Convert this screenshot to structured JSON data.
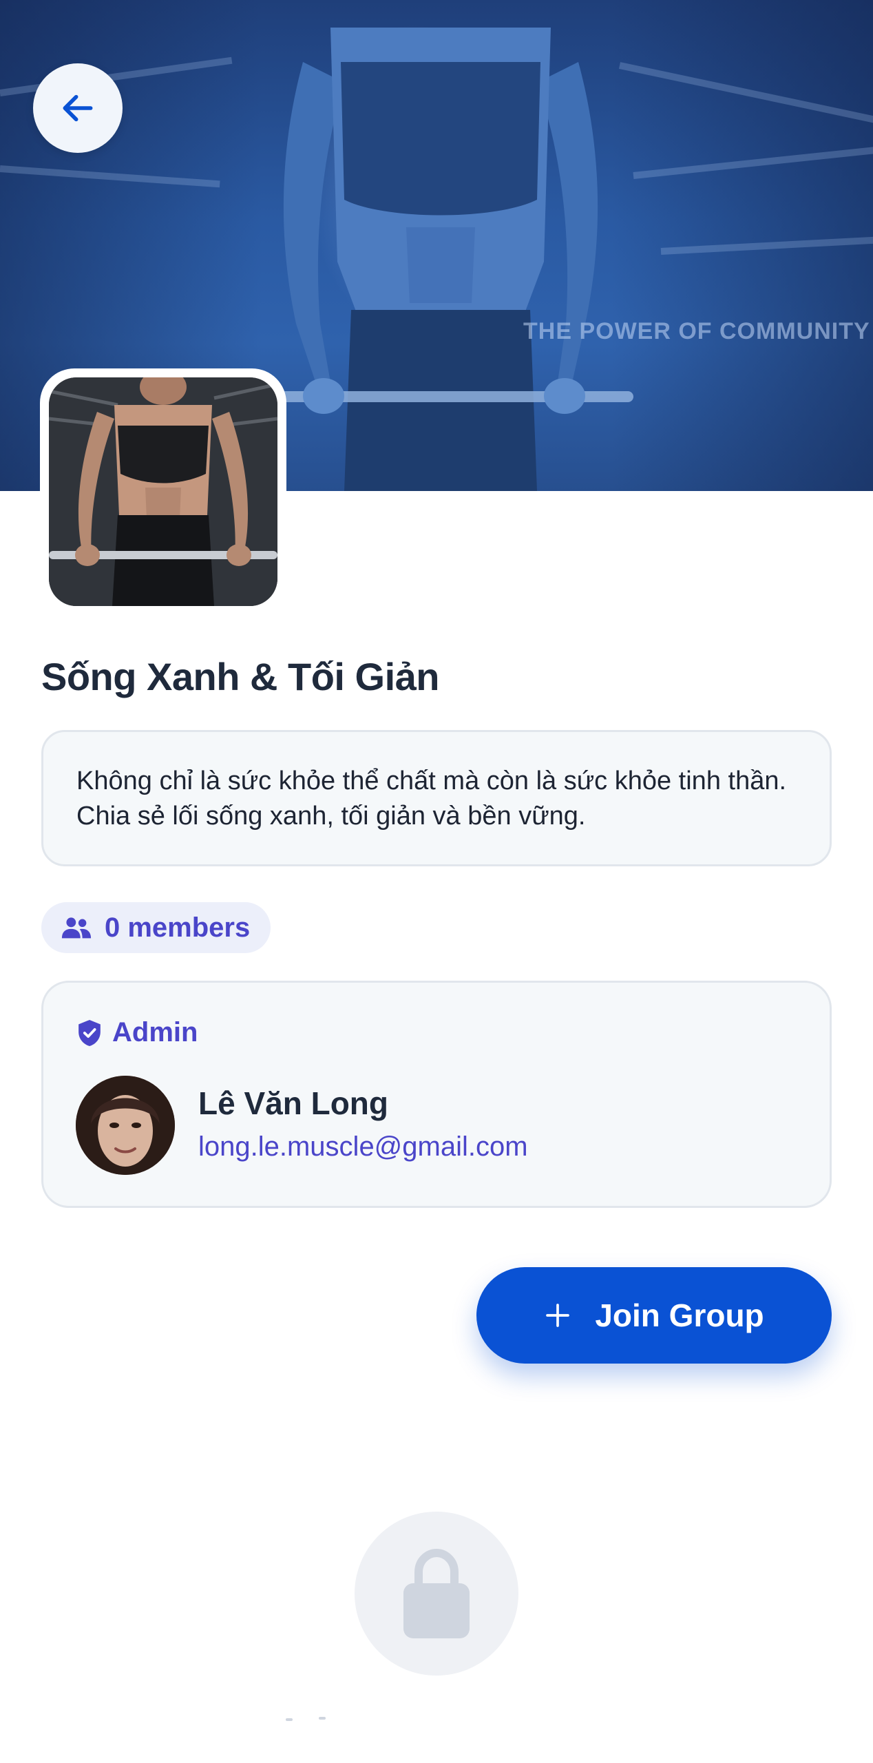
{
  "header": {
    "back_icon": "arrow-left-icon",
    "cover_text": "THE POWER OF COMMUNITY"
  },
  "group": {
    "name": "Sống Xanh & Tối Giản",
    "description": "Không chỉ là sức khỏe thể chất mà còn là sức khỏe tinh thần. Chia sẻ lối sống xanh, tối giản và bền vững.",
    "members_label": "0 members",
    "members_icon": "group-people-icon"
  },
  "admin": {
    "label": "Admin",
    "badge_icon": "shield-check-icon",
    "name": "Lê Văn Long",
    "email": "long.le.muscle@gmail.com"
  },
  "actions": {
    "join_label": "Join Group",
    "join_icon": "plus-icon"
  },
  "locked": {
    "icon": "lock-icon"
  },
  "colors": {
    "primary": "#0a52d4",
    "accent": "#4a45c9",
    "title": "#1f2a3c",
    "card_bg": "#f5f8fa",
    "card_border": "#e1e6ec",
    "pill_bg": "#eceffa",
    "lock_bg": "#eff1f5",
    "lock_icon": "#cfd5df"
  }
}
